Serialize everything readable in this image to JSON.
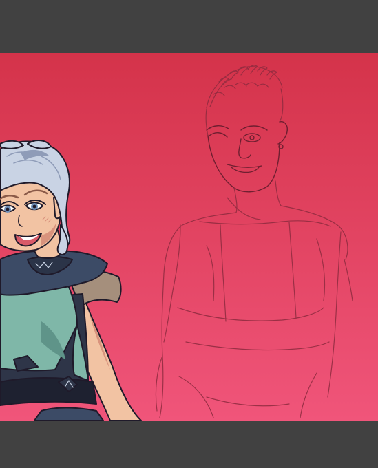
{
  "artwork": {
    "subject": "",
    "colors": {
      "chrome": "#414141",
      "gradient_top": "#d4334a",
      "gradient_bottom": "#f0557a",
      "line_art": "#8e2b3f",
      "ink": "#1f1a2a",
      "hair": "#c9d3e4",
      "hair_shadow": "#8f9cb8",
      "skin": "#f2c3a3",
      "skin_shadow": "#d9937d",
      "hood": "#3c4b66",
      "hood_dark": "#2b3448",
      "vest": "#7fb7a8",
      "vest_dark": "#5f9489",
      "shoulder_pad": "#a58f7c",
      "undershirt": "#2e3548",
      "belt": "#1e2130",
      "eye": "#6f8fb8",
      "lips": "#d85a68"
    }
  }
}
